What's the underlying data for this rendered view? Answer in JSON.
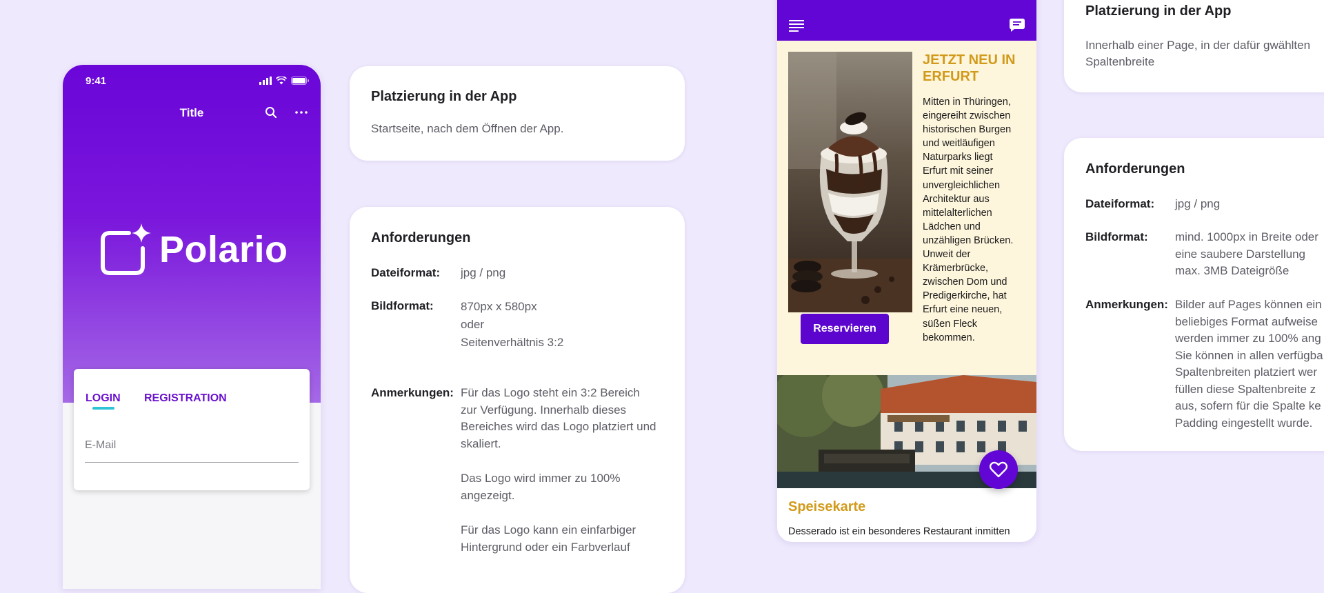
{
  "phone_login": {
    "time": "9:41",
    "nav_title": "Title",
    "logo_text": "Polario",
    "tabs": [
      {
        "label": "LOGIN",
        "active": true
      },
      {
        "label": "REGISTRATION",
        "active": false
      }
    ],
    "email_placeholder": "E-Mail",
    "accent_color": "#6a06d8",
    "tab_indicator_color": "#2ec3d6"
  },
  "card_placement_1": {
    "title": "Platzierung in der App",
    "text": "Startseite, nach dem Öffnen der App."
  },
  "card_requirements_1": {
    "title": "Anforderungen",
    "rows": [
      {
        "label": "Dateiformat:",
        "lines": [
          "jpg / png"
        ]
      },
      {
        "label": "Bildformat:",
        "lines": [
          "870px x 580px",
          "oder",
          "Seitenverhältnis 3:2"
        ]
      },
      {
        "label": "Anmerkungen:",
        "paragraphs": [
          [
            "Für das Logo steht ein 3:2 Bereich",
            "zur Verfügung. Innerhalb dieses",
            "Bereiches wird das Logo platziert und",
            "skaliert."
          ],
          [
            "Das Logo wird immer zu 100%",
            "angezeigt."
          ],
          [
            "Für das Logo kann ein einfarbiger",
            "Hintergrund oder ein Farbverlauf"
          ]
        ]
      }
    ]
  },
  "phone_restaurant": {
    "feature_title_lines": [
      "JETZT NEU IN",
      "ERFURT"
    ],
    "feature_text_lines": [
      "Mitten in Thüringen,",
      "eingereiht zwischen",
      "historischen Burgen",
      "und weitläufigen",
      "Naturparks liegt",
      "Erfurt mit seiner",
      "unvergleichlichen",
      "Architektur aus",
      "mittelalterlichen",
      "Lädchen und",
      "unzähligen Brücken.",
      "Unweit der",
      "Krämerbrücke,",
      "zwischen Dom und",
      "Predigerkirche, hat",
      "Erfurt eine neuen,",
      "süßen Fleck",
      "bekommen."
    ],
    "button_label": "Reservieren",
    "section_title": "Speisekarte",
    "section_text": "Desserado ist ein besonderes Restaurant inmitten",
    "bar_color": "#6106d5",
    "feature_bg": "#fdf5dc",
    "highlight_color": "#d29a1a"
  },
  "card_placement_2": {
    "title": "Platzierung in der App",
    "lines": [
      "Innerhalb einer Page, in der dafür gwählten",
      "Spaltenbreite"
    ]
  },
  "card_requirements_2": {
    "title": "Anforderungen",
    "rows": [
      {
        "label": "Dateiformat:",
        "lines": [
          "jpg / png"
        ]
      },
      {
        "label": "Bildformat:",
        "lines": [
          "mind. 1000px in Breite oder",
          "eine saubere Darstellung",
          "max. 3MB Dateigröße"
        ]
      },
      {
        "label": "Anmerkungen:",
        "lines": [
          "Bilder auf Pages können ein",
          "beliebiges Format aufweise",
          "werden immer zu 100% ang",
          "Sie können in allen verfügba",
          "Spaltenbreiten platziert wer",
          "füllen diese Spaltenbreite z",
          "aus, sofern für die Spalte ke",
          "Padding eingestellt wurde."
        ]
      }
    ]
  }
}
